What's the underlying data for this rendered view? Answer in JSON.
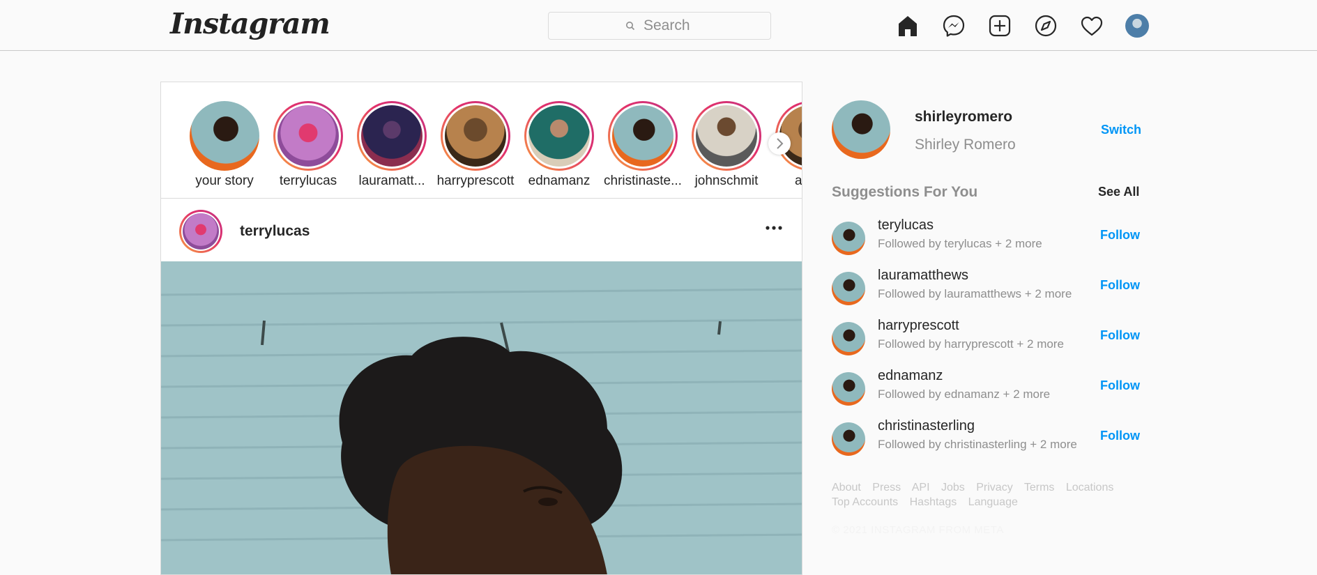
{
  "header": {
    "logo_text": "Instagram",
    "search_placeholder": "Search",
    "icons": [
      "home-icon",
      "messenger-icon",
      "new-post-icon",
      "explore-icon",
      "activity-heart-icon",
      "profile-avatar"
    ]
  },
  "stories": [
    {
      "username": "your story"
    },
    {
      "username": "terrylucas"
    },
    {
      "username": "lauramatt..."
    },
    {
      "username": "harryprescott"
    },
    {
      "username": "ednamanz"
    },
    {
      "username": "christinaste..."
    },
    {
      "username": "johnschmit"
    },
    {
      "username": "amy"
    }
  ],
  "post": {
    "username": "terrylucas"
  },
  "sidebar": {
    "username": "shirleyromero",
    "full_name": "Shirley Romero",
    "switch_label": "Switch",
    "suggestions_title": "Suggestions For You",
    "see_all_label": "See All",
    "suggestions": [
      {
        "username": "terylucas",
        "followed_by": "Followed by terylucas + 2 more",
        "action": "Follow"
      },
      {
        "username": "lauramatthews",
        "followed_by": "Followed by lauramatthews + 2 more",
        "action": "Follow"
      },
      {
        "username": "harryprescott",
        "followed_by": "Followed by harryprescott + 2 more",
        "action": "Follow"
      },
      {
        "username": "ednamanz",
        "followed_by": "Followed by ednamanz + 2 more",
        "action": "Follow"
      },
      {
        "username": "christinasterling",
        "followed_by": "Followed by christinasterling + 2 more",
        "action": "Follow"
      }
    ],
    "footer_links": [
      "About",
      "Press",
      "API",
      "Jobs",
      "Privacy",
      "Terms",
      "Locations",
      "Top Accounts",
      "Hashtags",
      "Language"
    ],
    "copyright": "© 2021 INSTAGRAM FROM META"
  },
  "colors": {
    "accent": "#0095f6",
    "story_ring": "#e1306c",
    "background": "#fafafa"
  }
}
